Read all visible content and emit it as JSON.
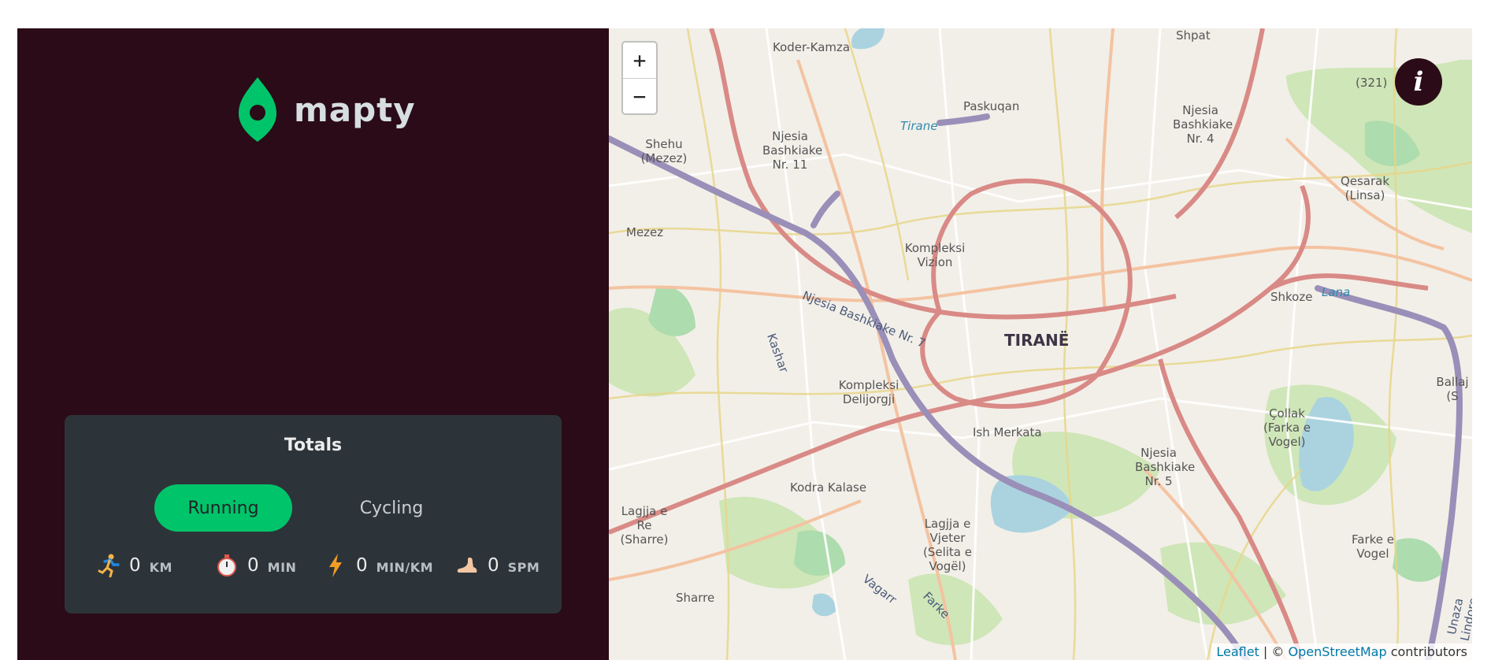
{
  "logo": {
    "text": "mapty",
    "icon": "map-pin-icon",
    "color": "#00c46a"
  },
  "totals": {
    "title": "Totals",
    "tabs": [
      {
        "label": "Running",
        "active": true
      },
      {
        "label": "Cycling",
        "active": false
      }
    ],
    "stats": [
      {
        "icon": "runner-icon",
        "value": "0",
        "unit": "KM"
      },
      {
        "icon": "stopwatch-icon",
        "value": "0",
        "unit": "MIN"
      },
      {
        "icon": "lightning-icon",
        "value": "0",
        "unit": "MIN/KM"
      },
      {
        "icon": "foot-icon",
        "value": "0",
        "unit": "SPM"
      }
    ]
  },
  "map": {
    "zoom_in": "+",
    "zoom_out": "−",
    "info_label": "i",
    "city": "TIRANË",
    "labels": [
      "Koder-Kamza",
      "Shpat",
      "Paskuqan",
      "Tirane",
      "Njesia Bashkiake Nr. 4",
      "(321)",
      "Shehu (Mezez)",
      "Njesia Bashkiake Nr. 11",
      "Qesarak (Linsa)",
      "Mezez",
      "Kompleksi Vizion",
      "Njesia Bashkiake Nr. 7",
      "Kashar",
      "Shkoze",
      "Lana",
      "Ballaj (S",
      "Kompleksi Delijorgji",
      "Ish Merkata",
      "Çollak (Farka e Vogel)",
      "Njesia Bashkiake Nr. 5",
      "Kodra Kalase",
      "Lagjja e Re (Sharre)",
      "Lagjja e Vjeter (Selita e Vogël)",
      "Farke e Vogel",
      "Vagarr",
      "Farke",
      "Sharre",
      "Unaza Lindore"
    ],
    "attribution": {
      "leaflet": "Leaflet",
      "sep": " | © ",
      "osm": "OpenStreetMap",
      "suffix": " contributors"
    }
  },
  "colors": {
    "sidebar": "#2a0b17",
    "panel": "#2d3439",
    "accent": "#00c46a"
  }
}
